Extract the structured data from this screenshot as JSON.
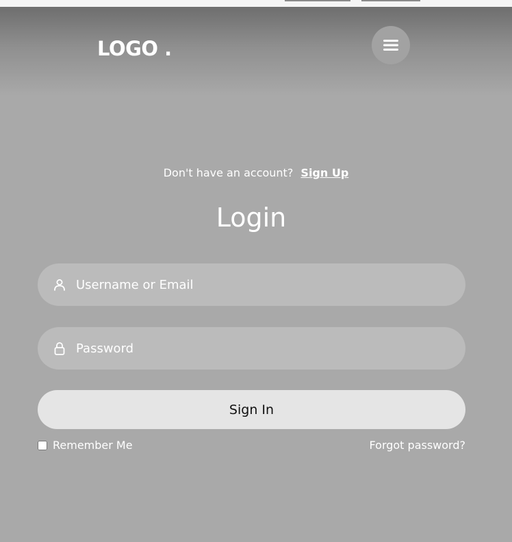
{
  "header": {
    "logo": "LOGO .",
    "menu_icon": "hamburger-menu-icon"
  },
  "signup": {
    "question": "Don't have an account?",
    "link": "Sign Up"
  },
  "form": {
    "title": "Login",
    "username_placeholder": "Username or Email",
    "username_icon": "user-icon",
    "password_placeholder": "Password",
    "password_icon": "lock-icon",
    "submit_label": "Sign In",
    "remember_label": "Remember Me",
    "remember_checked": false,
    "forgot_label": "Forgot password?"
  }
}
